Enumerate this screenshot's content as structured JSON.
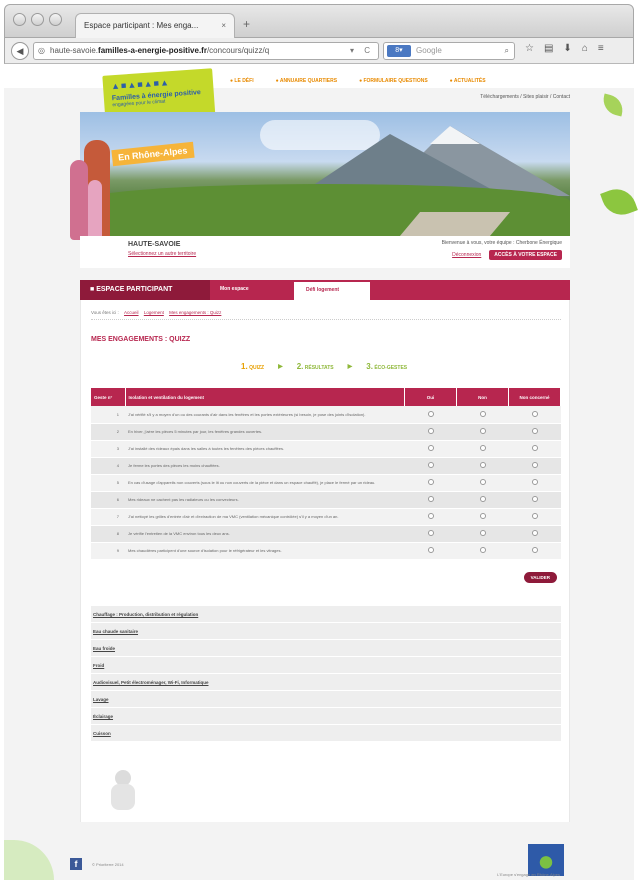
{
  "browser": {
    "tab_title": "Espace participant : Mes enga...",
    "url_pre": "haute-savoie.",
    "url_domain": "familles-a-energie-positive.fr",
    "url_post": "/concours/quizz/q",
    "search_placeholder": "Google"
  },
  "site": {
    "logo_title": "Familles à énergie positive",
    "logo_sub": "engagées pour le climat",
    "nav": [
      "LE DÉFI",
      "ANNUAIRE QUARTIERS",
      "FORMULAIRE QUESTIONS",
      "ACTUALITÉS"
    ],
    "subnav": "Téléchargements / Sites plaisir / Contact",
    "banner_badge": "En Rhône-Alpes",
    "region_name": "HAUTE-SAVOIE",
    "region_link": "Sélectionnez un autre territoire",
    "region_right_text": "Bienvenue à vous, votre équipe : Cherbone Énergique",
    "region_logout": "Déconnexion",
    "region_button": "ACCÈS À VOTRE ESPACE"
  },
  "espace": {
    "title": "ESPACE PARTICIPANT",
    "tabs": [
      "Mon espace",
      "Défi logement"
    ]
  },
  "breadcrumb": {
    "prefix": "Vous êtes ici :",
    "items": [
      "Accueil",
      "Logement",
      "Mes engagements : Quizz"
    ]
  },
  "page_title": "MES ENGAGEMENTS : QUIZZ",
  "steps": [
    {
      "num": "1.",
      "label": "QUIZZ"
    },
    {
      "num": "2.",
      "label": "RÉSULTATS"
    },
    {
      "num": "3.",
      "label": "ÉCO-GESTES"
    }
  ],
  "quiz": {
    "headers": {
      "num": "Geste n°",
      "question": "Isolation et ventilation du logement",
      "yes": "Oui",
      "no": "Non",
      "unconcerned": "Non concerné"
    },
    "rows": [
      {
        "num": "1",
        "text": "J'ai vérifié s'il y a moyen d'un ou des courants d'air dans les fenêtres et les portes extérieures (si besoin, je pose des joints d'isolation)."
      },
      {
        "num": "2",
        "text": "En hiver, j'aère les pièces 5 minutes par jour, les fenêtres grandes ouvertes."
      },
      {
        "num": "3",
        "text": "J'ai installé des rideaux épais dans les salles à toutes les fenêtres des pièces chauffées."
      },
      {
        "num": "4",
        "text": "Je ferme les portes des pièces les moins chauffées."
      },
      {
        "num": "5",
        "text": "En cas d'usage d'appareils non couverts (sous le lit ou non couverts de la pièce et dans un espace chauffé), je place le fermé par un rideau."
      },
      {
        "num": "6",
        "text": "Mes rideaux ne cachent pas les radiateurs ou les convecteurs."
      },
      {
        "num": "7",
        "text": "J'ai nettoyé les grilles d'entrée d'air et d'extraction de ma VMC (ventilation mécanique contrôlée) s'il y a moyen d'un an."
      },
      {
        "num": "8",
        "text": "Je vérifie l'entretien de la VMC environ tous les deux ans."
      },
      {
        "num": "9",
        "text": "Mes chaudières participent d'une source d'isolation pour le réfrigérateur et les vitrages."
      }
    ],
    "validate_label": "VALIDER"
  },
  "categories": [
    "Chauffage : Production, distribution et régulation",
    "Eau chaude sanitaire",
    "Eau froide",
    "Froid",
    "Audiovisuel, Petit électroménager, Wi-Fi, Informatique",
    "Lavage",
    "Éclairage",
    "Cuisson"
  ],
  "footer": {
    "copyright": "© Prioriterre 2014",
    "right_text": "L'Europe s'engage en Rhône-Alpes"
  }
}
